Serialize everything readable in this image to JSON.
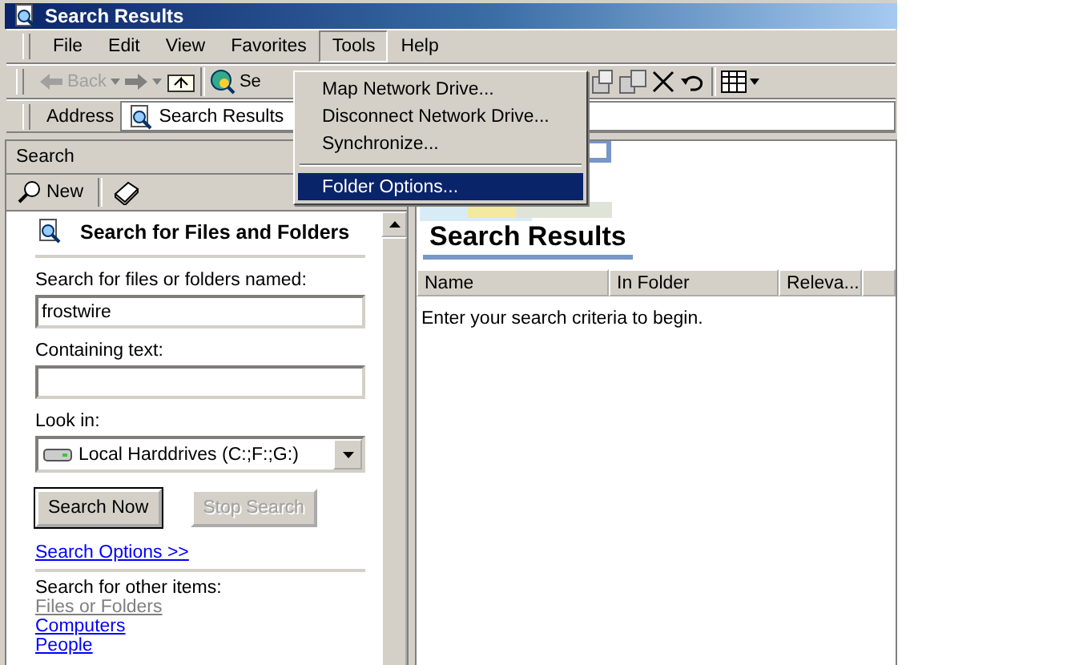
{
  "window": {
    "title": "Search Results"
  },
  "menu_bar": [
    {
      "label": "File",
      "selected": false
    },
    {
      "label": "Edit",
      "selected": false
    },
    {
      "label": "View",
      "selected": false
    },
    {
      "label": "Favorites",
      "selected": false
    },
    {
      "label": "Tools",
      "selected": true
    },
    {
      "label": "Help",
      "selected": false
    }
  ],
  "toolbar": {
    "back": {
      "label": "Back",
      "disabled": true
    },
    "search": {
      "label": "Se"
    }
  },
  "address": {
    "label": "Address",
    "value": "Search Results"
  },
  "tools_menu": [
    {
      "kind": "item",
      "label": "Map Network Drive...",
      "selected": false
    },
    {
      "kind": "item",
      "label": "Disconnect Network Drive...",
      "selected": false
    },
    {
      "kind": "item",
      "label": "Synchronize...",
      "selected": false
    },
    {
      "kind": "separator"
    },
    {
      "kind": "item",
      "label": "Folder Options...",
      "selected": true
    }
  ],
  "search_pane": {
    "title": "Search",
    "new_button": "New",
    "heading": "Search for Files and Folders",
    "name_label": "Search for files or folders named:",
    "name_value": "frostwire",
    "text_label": "Containing text:",
    "look_in_label": "Look in:",
    "look_in_value": "Local Harddrives (C:;F:;G:)",
    "buttons": [
      {
        "label": "Search Now",
        "disabled": false
      },
      {
        "label": "Stop Search",
        "disabled": true
      }
    ],
    "options_link": "Search Options >>",
    "other_label": "Search for other items:",
    "other_items": [
      {
        "label": "Files or Folders",
        "disabled": true
      },
      {
        "label": "Computers",
        "disabled": false
      },
      {
        "label": "People",
        "disabled": false
      }
    ]
  },
  "results": {
    "heading": "Search Results",
    "columns": [
      "Name",
      "In Folder",
      "Releva..."
    ],
    "message": "Enter your search criteria to begin."
  }
}
